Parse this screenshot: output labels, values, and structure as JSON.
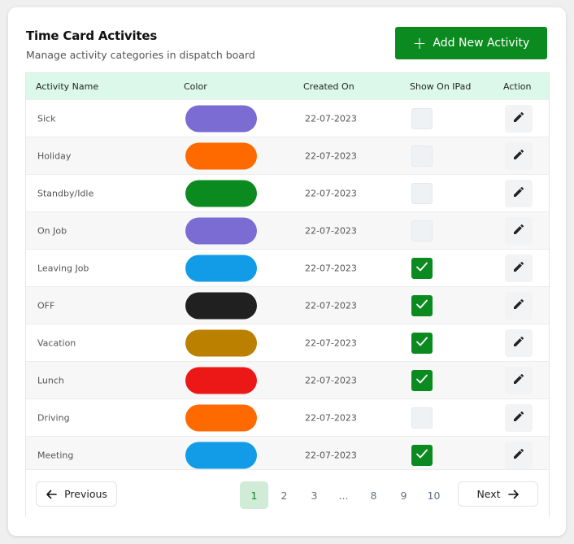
{
  "header": {
    "title": "Time Card Activites",
    "subtitle": "Manage activity categories in dispatch board",
    "add_button_label": "Add New Activity",
    "add_button_icon": "plus-icon"
  },
  "colors": {
    "accent": "#0b8a1f",
    "header_bg": "#dcf8ea",
    "active_page_bg": "#d0ebd6"
  },
  "table": {
    "columns": [
      "Activity Name",
      "Color",
      "Created On",
      "Show On IPad",
      "Action"
    ],
    "rows": [
      {
        "name": "Sick",
        "color": "#7b6cd3",
        "created_on": "22-07-2023",
        "show_on_ipad": false
      },
      {
        "name": "Holiday",
        "color": "#ff6a00",
        "created_on": "22-07-2023",
        "show_on_ipad": false
      },
      {
        "name": "Standby/Idle",
        "color": "#0b8a1f",
        "created_on": "22-07-2023",
        "show_on_ipad": false
      },
      {
        "name": "On Job",
        "color": "#7b6cd3",
        "created_on": "22-07-2023",
        "show_on_ipad": false
      },
      {
        "name": "Leaving Job",
        "color": "#129ce8",
        "created_on": "22-07-2023",
        "show_on_ipad": true
      },
      {
        "name": "OFF",
        "color": "#202020",
        "created_on": "22-07-2023",
        "show_on_ipad": true
      },
      {
        "name": "Vacation",
        "color": "#bb8000",
        "created_on": "22-07-2023",
        "show_on_ipad": true
      },
      {
        "name": "Lunch",
        "color": "#ec1818",
        "created_on": "22-07-2023",
        "show_on_ipad": true
      },
      {
        "name": "Driving",
        "color": "#ff6a00",
        "created_on": "22-07-2023",
        "show_on_ipad": false
      },
      {
        "name": "Meeting",
        "color": "#129ce8",
        "created_on": "22-07-2023",
        "show_on_ipad": true
      }
    ],
    "action_icon": "pencil-icon"
  },
  "pagination": {
    "previous_label": "Previous",
    "next_label": "Next",
    "pages": [
      "1",
      "2",
      "3",
      "...",
      "8",
      "9",
      "10"
    ],
    "current_page": "1"
  }
}
